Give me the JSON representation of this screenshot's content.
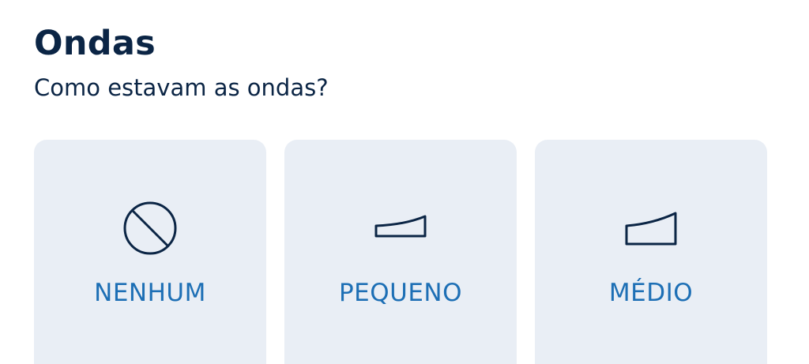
{
  "section": {
    "title": "Ondas",
    "subtitle": "Como estavam as ondas?"
  },
  "options": [
    {
      "label": "NENHUM",
      "icon": "none-icon"
    },
    {
      "label": "PEQUENO",
      "icon": "small-wave-icon"
    },
    {
      "label": "MÉDIO",
      "icon": "medium-wave-icon"
    }
  ],
  "colors": {
    "title": "#0b2545",
    "card_background": "#e9eef5",
    "label": "#1d6fb5",
    "icon_stroke": "#0b2545"
  }
}
